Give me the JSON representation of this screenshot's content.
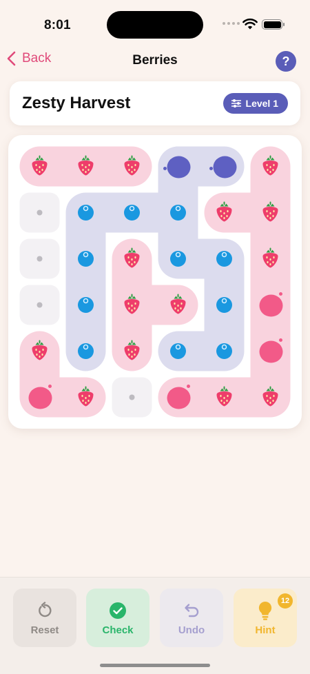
{
  "status": {
    "time": "8:01"
  },
  "nav": {
    "back_label": "Back",
    "title": "Berries",
    "help_label": "?"
  },
  "header": {
    "puzzle_title": "Zesty Harvest",
    "level_label": "Level 1"
  },
  "board": {
    "size": 6,
    "cells": [
      [
        "straw",
        "straw",
        "straw",
        "blueBig",
        "blueBig",
        "straw"
      ],
      [
        "empty",
        "blue",
        "blue",
        "blue",
        "straw",
        "straw"
      ],
      [
        "empty",
        "blue",
        "straw",
        "blue",
        "blue",
        "straw"
      ],
      [
        "empty",
        "blue",
        "straw",
        "straw",
        "blue",
        "pinkBig"
      ],
      [
        "straw",
        "blue",
        "straw",
        "blue",
        "blue",
        "pinkBig"
      ],
      [
        "pinkBig",
        "straw",
        "empty",
        "pinkBig",
        "straw",
        "straw"
      ]
    ],
    "pink_paths": [
      [
        [
          0,
          0
        ],
        [
          0,
          1
        ],
        [
          0,
          2
        ]
      ],
      [
        [
          0,
          5
        ],
        [
          1,
          5
        ],
        [
          2,
          5
        ],
        [
          3,
          5
        ],
        [
          4,
          5
        ],
        [
          5,
          5
        ],
        [
          5,
          4
        ],
        [
          5,
          3
        ]
      ],
      [
        [
          1,
          4
        ],
        [
          1,
          5
        ]
      ],
      [
        [
          2,
          2
        ],
        [
          3,
          2
        ],
        [
          4,
          2
        ]
      ],
      [
        [
          3,
          2
        ],
        [
          3,
          3
        ]
      ],
      [
        [
          4,
          0
        ],
        [
          5,
          0
        ],
        [
          5,
          1
        ]
      ]
    ],
    "blue_paths": [
      [
        [
          0,
          3
        ],
        [
          0,
          4
        ]
      ],
      [
        [
          0,
          3
        ],
        [
          1,
          3
        ],
        [
          1,
          2
        ],
        [
          1,
          1
        ],
        [
          2,
          1
        ],
        [
          3,
          1
        ],
        [
          4,
          1
        ]
      ],
      [
        [
          1,
          3
        ],
        [
          2,
          3
        ],
        [
          2,
          4
        ],
        [
          3,
          4
        ],
        [
          4,
          4
        ],
        [
          4,
          3
        ]
      ]
    ],
    "colors": {
      "pink_track": "#f9d3de",
      "blue_track": "#dcdcee",
      "empty_track": "#f3f1f4",
      "strawberry": "#ee3d6b",
      "strawberry_leaf": "#2f9e44",
      "blueberry": "#1a98e0",
      "blue_big": "#5e60c2",
      "pink_big": "#f25a88"
    }
  },
  "toolbar": {
    "reset_label": "Reset",
    "check_label": "Check",
    "undo_label": "Undo",
    "hint_label": "Hint",
    "hint_count": "12"
  }
}
